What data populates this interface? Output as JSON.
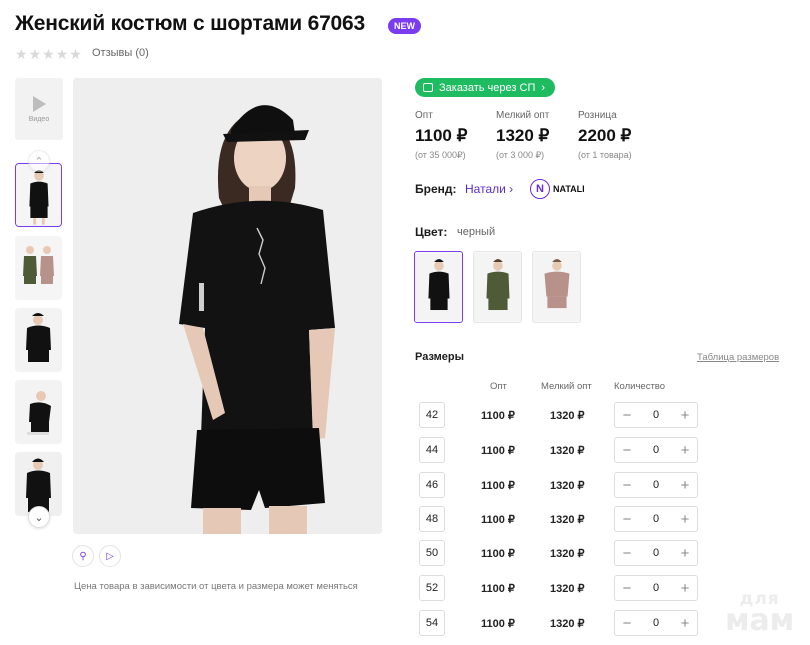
{
  "product": {
    "title": "Женский костюм с шортами 67063",
    "badge": "NEW",
    "rating_stars": 0,
    "reviews": "Отзывы (0)"
  },
  "gallery": {
    "video_label": "Видео",
    "thumbnail_count": 5,
    "price_note": "Цена товара в зависимости от цвета и размера может меняться"
  },
  "order": {
    "sp_button": "Заказать через СП"
  },
  "prices": [
    {
      "label": "Опт",
      "value": "1100 ₽",
      "min": "(от 35 000₽)"
    },
    {
      "label": "Мелкий опт",
      "value": "1320 ₽",
      "min": "(от 3 000 ₽)"
    },
    {
      "label": "Розница",
      "value": "2200 ₽",
      "min": "(от 1 товара)"
    }
  ],
  "brand": {
    "label": "Бренд:",
    "name": "Натали",
    "logo_letter": "N",
    "logo_text": "NATALI"
  },
  "color": {
    "label": "Цвет:",
    "value": "черный",
    "swatches": [
      "black",
      "olive",
      "pink-beige"
    ]
  },
  "sizes": {
    "title": "Размеры",
    "chart_link": "Таблица размеров",
    "headers": {
      "opt": "Опт",
      "small_opt": "Мелкий опт",
      "qty": "Количество"
    },
    "rows": [
      {
        "size": "42",
        "opt": "1100 ₽",
        "small_opt": "1320 ₽",
        "qty": "0"
      },
      {
        "size": "44",
        "opt": "1100 ₽",
        "small_opt": "1320 ₽",
        "qty": "0"
      },
      {
        "size": "46",
        "opt": "1100 ₽",
        "small_opt": "1320 ₽",
        "qty": "0"
      },
      {
        "size": "48",
        "opt": "1100 ₽",
        "small_opt": "1320 ₽",
        "qty": "0"
      },
      {
        "size": "50",
        "opt": "1100 ₽",
        "small_opt": "1320 ₽",
        "qty": "0"
      },
      {
        "size": "52",
        "opt": "1100 ₽",
        "small_opt": "1320 ₽",
        "qty": "0"
      },
      {
        "size": "54",
        "opt": "1100 ₽",
        "small_opt": "1320 ₽",
        "qty": "0"
      }
    ]
  },
  "watermark": {
    "top": "для",
    "bottom": "мам"
  },
  "colors": {
    "accent": "#7b3bf0",
    "green": "#1fbb61",
    "brand_link": "#5a2fc2"
  }
}
